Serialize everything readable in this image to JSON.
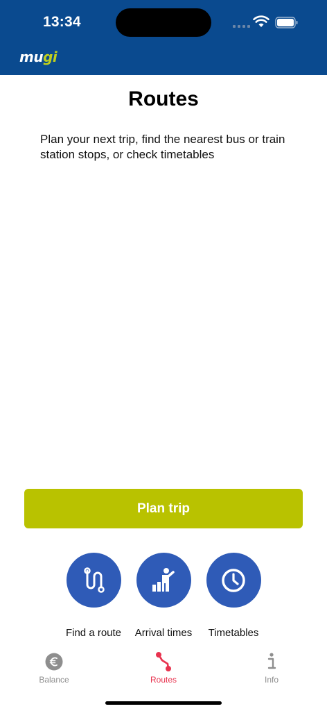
{
  "status_bar": {
    "time": "13:34"
  },
  "app": {
    "logo_part1": "mu",
    "logo_part2": "gi",
    "brand_colors": {
      "header": "#0a4a8f",
      "lime": "#b9c200",
      "blue": "#2f5bb7",
      "active_tab": "#e8334f"
    }
  },
  "main": {
    "title": "Routes",
    "description": "Plan your next trip, find the nearest bus or train station stops, or check timetables",
    "plan_button_label": "Plan trip"
  },
  "actions": [
    {
      "label": "Find a route",
      "icon": "route-icon"
    },
    {
      "label": "Arrival times",
      "icon": "waiting-person-icon"
    },
    {
      "label": "Timetables",
      "icon": "clock-icon"
    }
  ],
  "tabbar": [
    {
      "label": "Balance",
      "icon": "euro-icon",
      "active": false
    },
    {
      "label": "Routes",
      "icon": "routes-icon",
      "active": true
    },
    {
      "label": "Info",
      "icon": "info-icon",
      "active": false
    }
  ]
}
